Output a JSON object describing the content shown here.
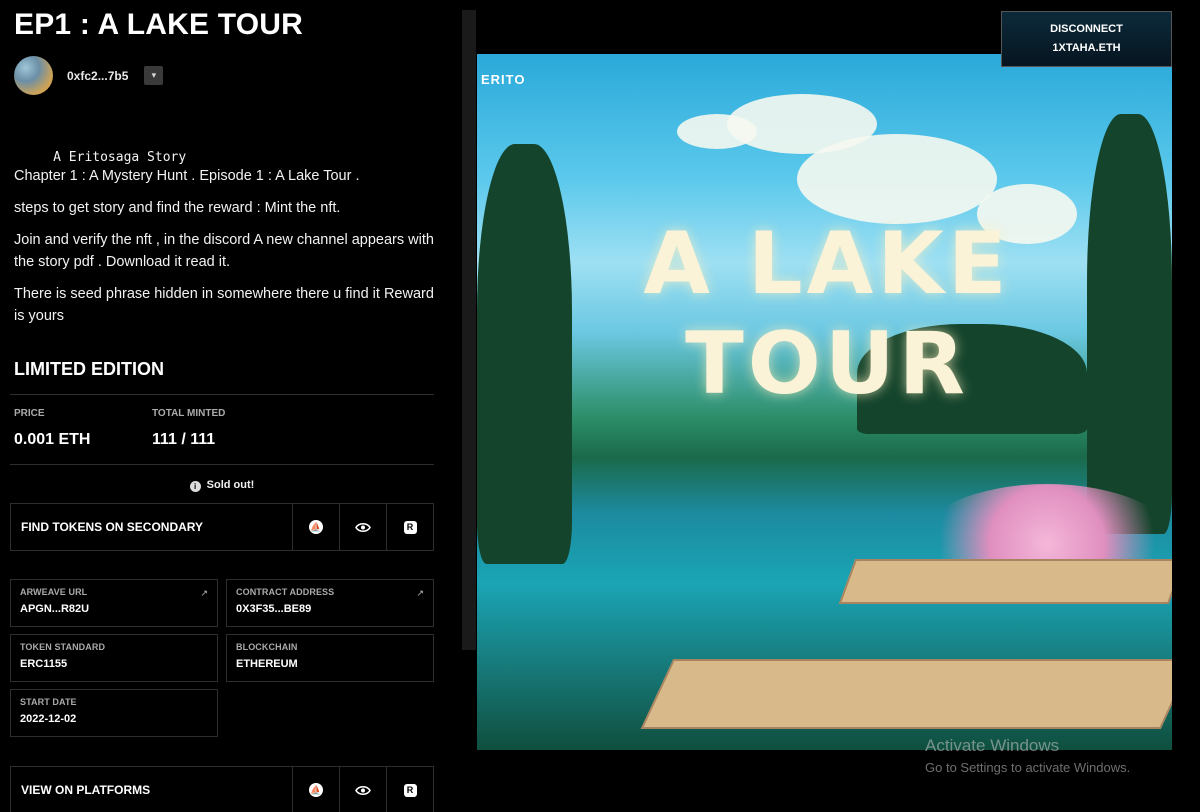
{
  "page": {
    "title": "EP1 : A LAKE TOUR",
    "creator_address": "0xfc2...7b5",
    "menu_glyph": "▾"
  },
  "description": {
    "heading": "     A Eritosaga Story",
    "lines": [
      "Chapter 1 : A Mystery Hunt . Episode 1 : A Lake Tour .",
      "steps to get story and find the reward : Mint the nft.",
      "Join and verify the nft , in the discord A new channel appears with the story pdf . Download it read it.",
      "There is seed phrase hidden in somewhere there u find it Reward is yours"
    ]
  },
  "edition": {
    "heading": "LIMITED EDITION",
    "price_label": "PRICE",
    "price_value": "0.001 ETH",
    "minted_label": "TOTAL MINTED",
    "minted_value": "111 / 111",
    "status": "Sold out!",
    "status_icon": "i"
  },
  "secondary": {
    "label": "FIND TOKENS ON SECONDARY",
    "icons": [
      "opensea-icon",
      "eye-icon",
      "rarible-icon"
    ]
  },
  "details": {
    "arweave_label": "ARWEAVE URL",
    "arweave_value": "APGN...R82U",
    "contract_label": "CONTRACT ADDRESS",
    "contract_value": "0X3F35...BE89",
    "standard_label": "TOKEN STANDARD",
    "standard_value": "ERC1155",
    "blockchain_label": "BLOCKCHAIN",
    "blockchain_value": "ETHEREUM",
    "start_label": "START DATE",
    "start_value": "2022-12-02",
    "external_glyph": "↗"
  },
  "platforms": {
    "label": "VIEW ON PLATFORMS"
  },
  "artwork": {
    "logo_text": "ERITO",
    "title_text": "A LAKE TOUR"
  },
  "wallet": {
    "line1": "DISCONNECT",
    "line2": "1XTAHA.ETH"
  },
  "watermark": {
    "line1": "Activate Windows",
    "line2": "Go to Settings to activate Windows."
  }
}
